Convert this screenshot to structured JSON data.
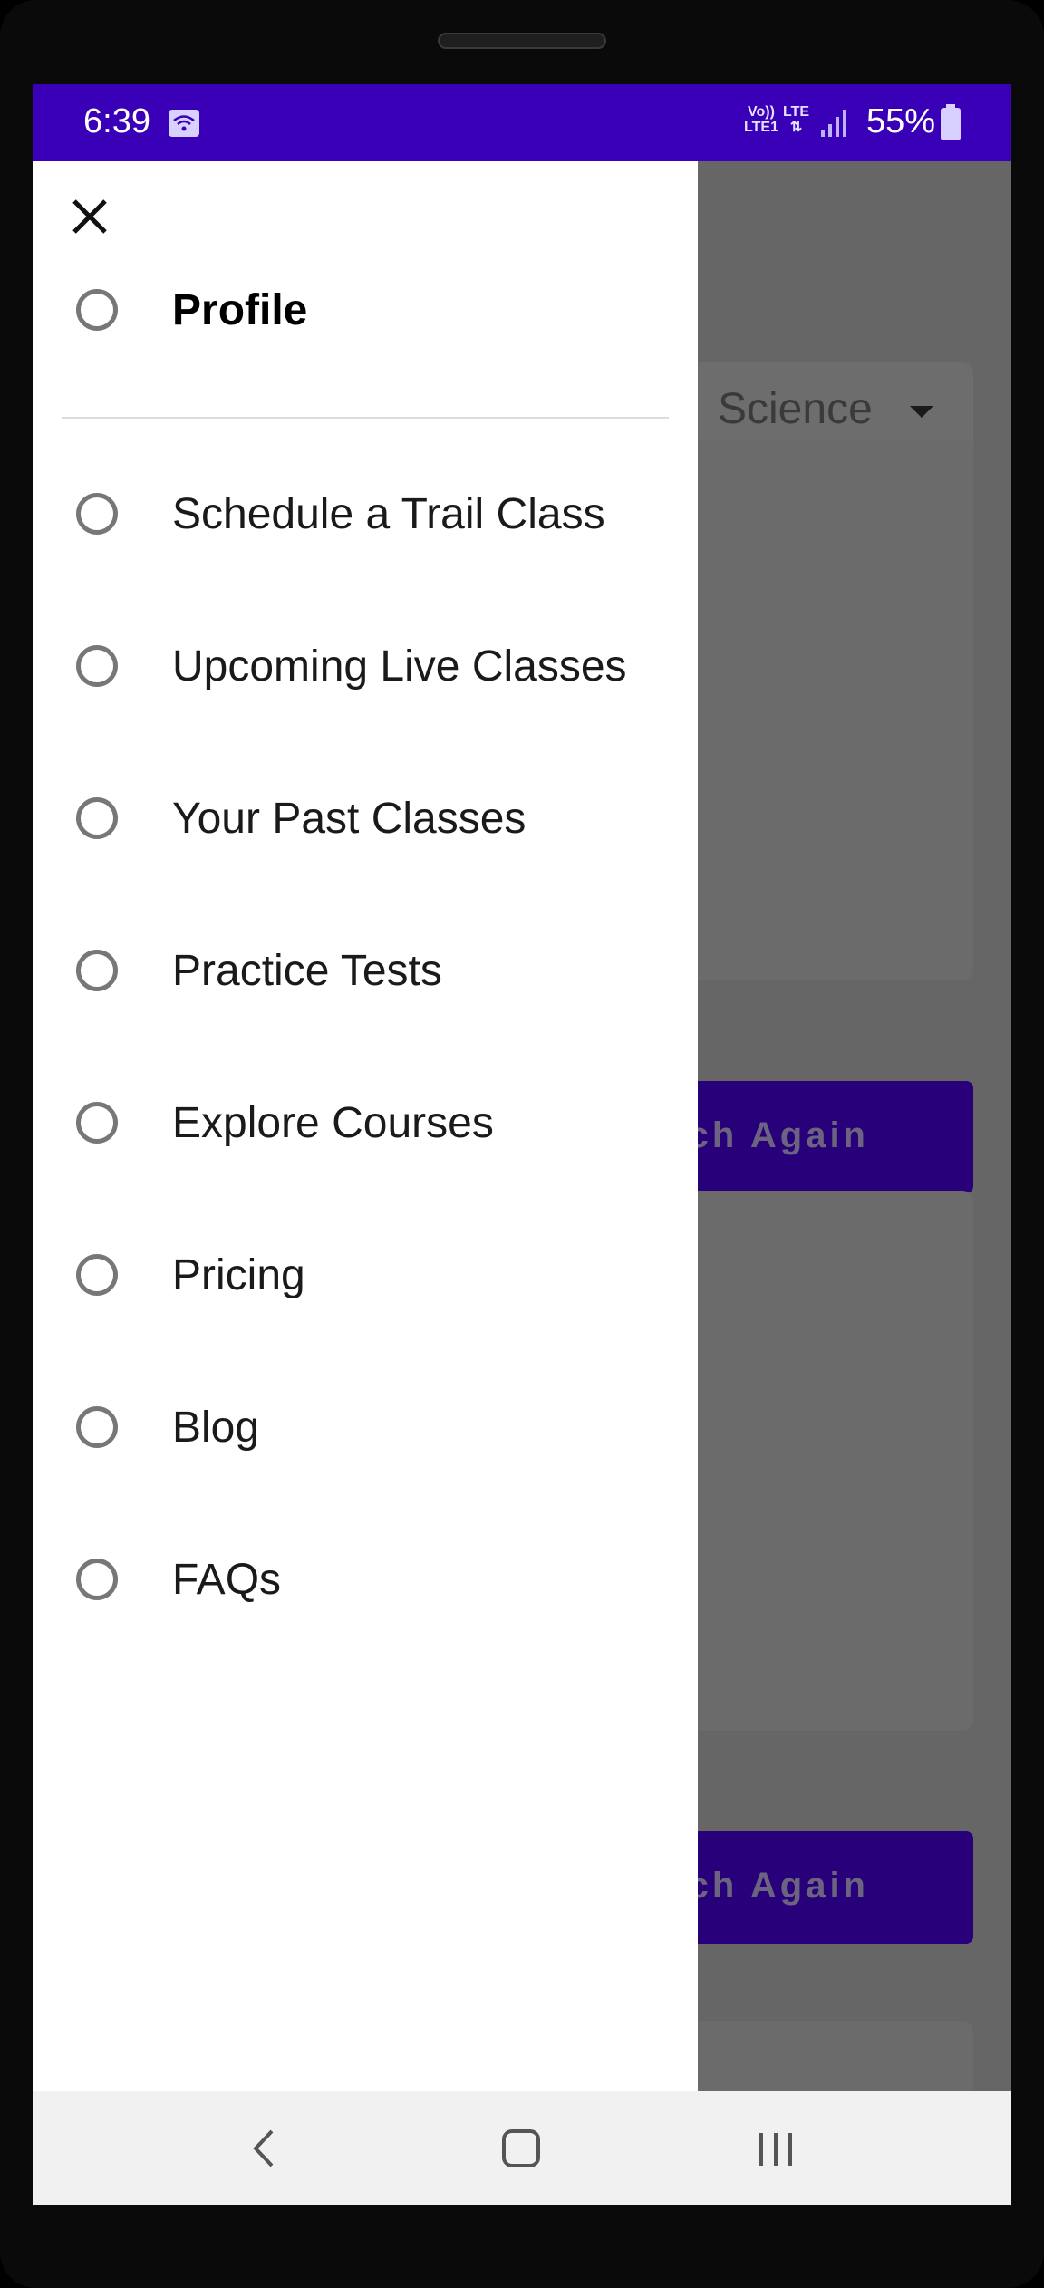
{
  "status_bar": {
    "time": "6:39",
    "network_top": "Vo)) LTE1",
    "network_lte": "LTE",
    "battery": "55%",
    "color": "#3a00b8"
  },
  "background_screen": {
    "dropdown_value": "Science",
    "buttons": [
      "atch Again",
      "atch Again"
    ]
  },
  "drawer": {
    "close_icon": "close-icon",
    "profile_label": "Profile",
    "items": [
      {
        "label": "Schedule a Trail Class"
      },
      {
        "label": "Upcoming Live Classes"
      },
      {
        "label": "Your Past Classes"
      },
      {
        "label": "Practice Tests"
      },
      {
        "label": "Explore Courses"
      },
      {
        "label": "Pricing"
      },
      {
        "label": "Blog"
      },
      {
        "label": "FAQs"
      }
    ]
  },
  "nav_bar": {
    "back_icon": "back-icon",
    "home_icon": "home-icon",
    "recents_icon": "recents-icon"
  }
}
